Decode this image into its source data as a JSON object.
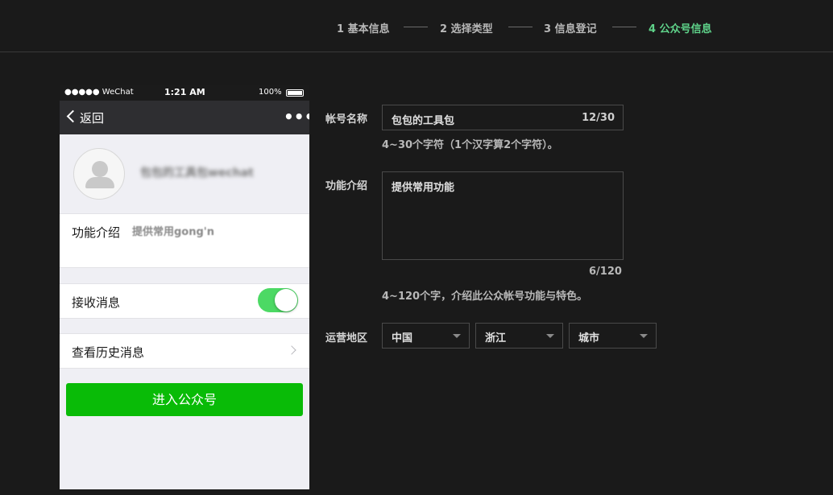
{
  "stepper": {
    "steps": [
      {
        "label": "1 基本信息",
        "active": false
      },
      {
        "label": "2 选择类型",
        "active": false
      },
      {
        "label": "3 信息登记",
        "active": false
      },
      {
        "label": "4 公众号信息",
        "active": true
      }
    ],
    "active_color": "#5fd38a"
  },
  "phone": {
    "status_bar": {
      "carrier": "●●●●● WeChat ︎",
      "time": "1:21 AM",
      "battery": "100%"
    },
    "nav": {
      "back_label": "返回",
      "more_icon": "more-dots-icon"
    },
    "profile": {
      "name_blurred": "包包的工具包wechat",
      "avatar_icon": "default-avatar-icon"
    },
    "func_intro": {
      "label": "功能介绍",
      "value": "提供常用gong'n"
    },
    "receive_messages": {
      "label": "接收消息",
      "enabled": true,
      "toggle_color": "#4cd964"
    },
    "history": {
      "label": "查看历史消息"
    },
    "enter_button": {
      "label": "进入公众号",
      "color": "#09bb07"
    }
  },
  "form": {
    "account_name": {
      "label": "帐号名称",
      "value": "包包的工具包",
      "count": "12/30",
      "hint": "4~30个字符（1个汉字算2个字符）。"
    },
    "function_intro": {
      "label": "功能介绍",
      "value": "提供常用功能",
      "count": "6/120",
      "hint": "4~120个字，介绍此公众帐号功能与特色。"
    },
    "region": {
      "label": "运营地区",
      "country": "中国",
      "province": "浙江",
      "city": "城市"
    }
  }
}
